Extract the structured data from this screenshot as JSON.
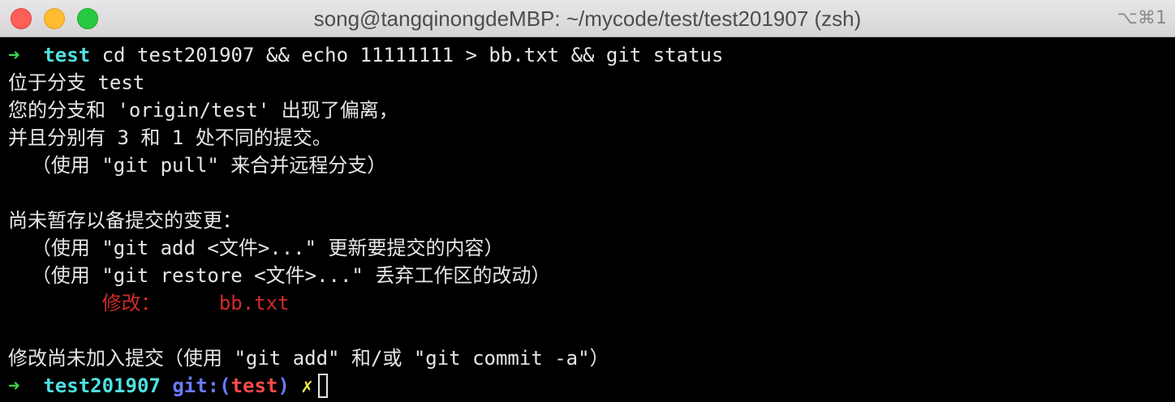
{
  "window": {
    "title": "song@tangqinongdeMBP: ~/mycode/test/test201907 (zsh)",
    "shortcut": "⌥⌘1"
  },
  "terminal": {
    "prompt1": {
      "arrow": "➜",
      "dir": "test",
      "command": "cd test201907 && echo 11111111 > bb.txt && git status"
    },
    "output": {
      "line1": "位于分支 test",
      "line2": "您的分支和 'origin/test' 出现了偏离，",
      "line3": "并且分别有 3 和 1 处不同的提交。",
      "line4": "  （使用 \"git pull\" 来合并远程分支）",
      "line5": "",
      "line6": "尚未暂存以备提交的变更：",
      "line7": "  （使用 \"git add <文件>...\" 更新要提交的内容）",
      "line8": "  （使用 \"git restore <文件>...\" 丢弃工作区的改动）",
      "modified_label": "修改：",
      "modified_file": "bb.txt",
      "line10": "",
      "line11": "修改尚未加入提交（使用 \"git add\" 和/或 \"git commit -a\"）"
    },
    "prompt2": {
      "arrow": "➜",
      "dir": "test201907",
      "git_label": "git:(",
      "branch": "test",
      "git_close": ")",
      "dirty": "✗"
    }
  },
  "colors": {
    "background": "#000000",
    "arrow": "#3cd64b",
    "dir": "#4fe0e0",
    "git": "#6b7bff",
    "branch": "#ff4a4a",
    "dirty": "#f2e84b",
    "modified": "#d22a2a"
  }
}
